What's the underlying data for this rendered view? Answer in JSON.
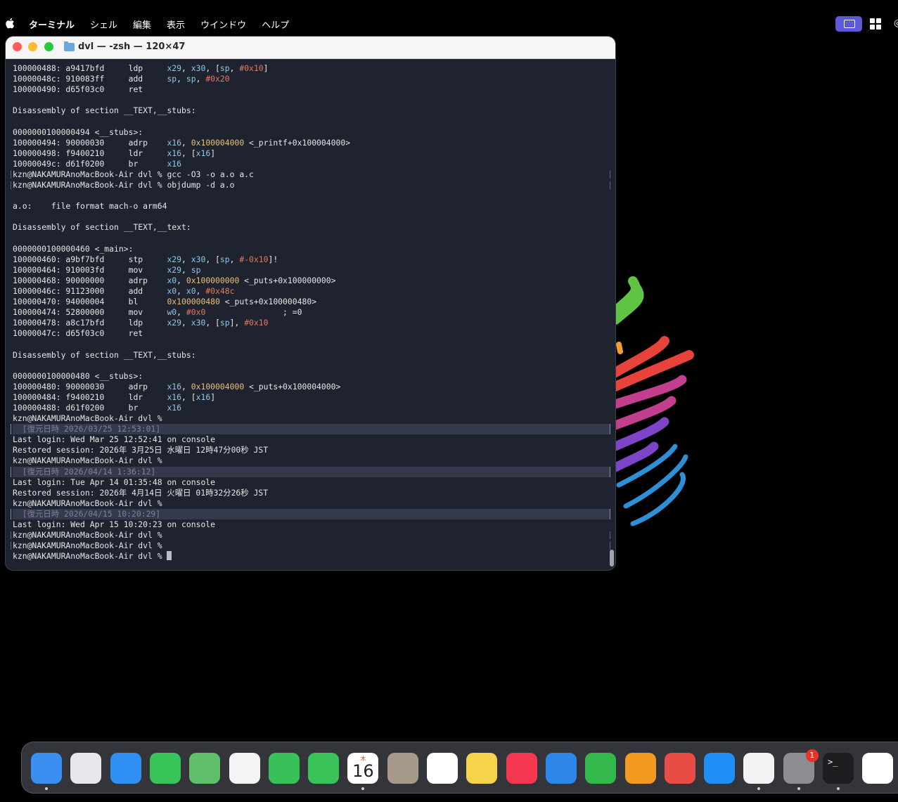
{
  "menubar": {
    "app_name": "ターミナル",
    "items": [
      "シェル",
      "編集",
      "表示",
      "ウインドウ",
      "ヘルプ"
    ]
  },
  "window": {
    "title": "dvl — -zsh — 120×47"
  },
  "terminal": {
    "lines": [
      {
        "t": "plain",
        "s": "100000488: a9417bfd     ldp     x29, x30, [sp, #0x10]"
      },
      {
        "t": "plain",
        "s": "10000048c: 910083ff     add     sp, sp, #0x20"
      },
      {
        "t": "plain",
        "s": "100000490: d65f03c0     ret"
      },
      {
        "t": "plain",
        "s": ""
      },
      {
        "t": "plain",
        "s": "Disassembly of section __TEXT,__stubs:"
      },
      {
        "t": "plain",
        "s": ""
      },
      {
        "t": "plain",
        "s": "0000000100000494 <__stubs>:"
      },
      {
        "t": "plain",
        "s": "100000494: 90000030     adrp    x16, 0x100004000 <_printf+0x100004000>"
      },
      {
        "t": "plain",
        "s": "100000498: f9400210     ldr     x16, [x16]"
      },
      {
        "t": "plain",
        "s": "10000049c: d61f0200     br      x16"
      },
      {
        "t": "prompt",
        "s": "kzn@NAKAMURAnoMacBook-Air dvl % gcc -O3 -o a.o a.c"
      },
      {
        "t": "prompt",
        "s": "kzn@NAKAMURAnoMacBook-Air dvl % objdump -d a.o"
      },
      {
        "t": "plain",
        "s": ""
      },
      {
        "t": "plain",
        "s": "a.o:    file format mach-o arm64"
      },
      {
        "t": "plain",
        "s": ""
      },
      {
        "t": "plain",
        "s": "Disassembly of section __TEXT,__text:"
      },
      {
        "t": "plain",
        "s": ""
      },
      {
        "t": "plain",
        "s": "0000000100000460 <_main>:"
      },
      {
        "t": "plain",
        "s": "100000460: a9bf7bfd     stp     x29, x30, [sp, #-0x10]!"
      },
      {
        "t": "plain",
        "s": "100000464: 910003fd     mov     x29, sp"
      },
      {
        "t": "plain",
        "s": "100000468: 90000000     adrp    x0, 0x100000000 <_puts+0x100000000>"
      },
      {
        "t": "plain",
        "s": "10000046c: 91123000     add     x0, x0, #0x48c"
      },
      {
        "t": "plain",
        "s": "100000470: 94000004     bl      0x100000480 <_puts+0x100000480>"
      },
      {
        "t": "plain",
        "s": "100000474: 52800000     mov     w0, #0x0                ; =0"
      },
      {
        "t": "plain",
        "s": "100000478: a8c17bfd     ldp     x29, x30, [sp], #0x10"
      },
      {
        "t": "plain",
        "s": "10000047c: d65f03c0     ret"
      },
      {
        "t": "plain",
        "s": ""
      },
      {
        "t": "plain",
        "s": "Disassembly of section __TEXT,__stubs:"
      },
      {
        "t": "plain",
        "s": ""
      },
      {
        "t": "plain",
        "s": "0000000100000480 <__stubs>:"
      },
      {
        "t": "plain",
        "s": "100000480: 90000030     adrp    x16, 0x100004000 <_puts+0x100004000>"
      },
      {
        "t": "plain",
        "s": "100000484: f9400210     ldr     x16, [x16]"
      },
      {
        "t": "plain",
        "s": "100000488: d61f0200     br      x16"
      },
      {
        "t": "plain",
        "s": "kzn@NAKAMURAnoMacBook-Air dvl %"
      },
      {
        "t": "mark",
        "s": "  [復元日時 2026/03/25 12:53:01]"
      },
      {
        "t": "plain",
        "s": "Last login: Wed Mar 25 12:52:41 on console"
      },
      {
        "t": "plain",
        "s": "Restored session: 2026年 3月25日 水曜日 12時47分00秒 JST"
      },
      {
        "t": "plain",
        "s": "kzn@NAKAMURAnoMacBook-Air dvl %"
      },
      {
        "t": "mark",
        "s": "  [復元日時 2026/04/14 1:36:12]"
      },
      {
        "t": "plain",
        "s": "Last login: Tue Apr 14 01:35:48 on console"
      },
      {
        "t": "plain",
        "s": "Restored session: 2026年 4月14日 火曜日 01時32分26秒 JST"
      },
      {
        "t": "plain",
        "s": "kzn@NAKAMURAnoMacBook-Air dvl %"
      },
      {
        "t": "mark",
        "s": "  [復元日時 2026/04/15 10:20:29]"
      },
      {
        "t": "plain",
        "s": "Last login: Wed Apr 15 10:20:23 on console"
      },
      {
        "t": "prompt",
        "s": "kzn@NAKAMURAnoMacBook-Air dvl %"
      },
      {
        "t": "prompt",
        "s": "kzn@NAKAMURAnoMacBook-Air dvl %"
      },
      {
        "t": "cursor",
        "s": "kzn@NAKAMURAnoMacBook-Air dvl % "
      }
    ]
  },
  "dock": {
    "items": [
      {
        "name": "finder-icon",
        "color": "#3b8ff0",
        "running": true
      },
      {
        "name": "launchpad-icon",
        "color": "#e8e8ec",
        "running": false
      },
      {
        "name": "safari-icon",
        "color": "#2f8ff2",
        "running": false
      },
      {
        "name": "messages-icon",
        "color": "#39c45a",
        "running": false
      },
      {
        "name": "maps-icon",
        "color": "#5fbf6a",
        "running": false
      },
      {
        "name": "photos-icon",
        "color": "#f4f4f4",
        "running": false
      },
      {
        "name": "facetime-icon",
        "color": "#37c158",
        "running": false
      },
      {
        "name": "phone-icon",
        "color": "#38c257",
        "running": false
      },
      {
        "name": "calendar-icon",
        "color": "#ffffff",
        "running": true
      },
      {
        "name": "contacts-icon",
        "color": "#a6998a",
        "running": false
      },
      {
        "name": "reminders-icon",
        "color": "#ffffff",
        "running": false
      },
      {
        "name": "notes-icon",
        "color": "#f5d34a",
        "running": false
      },
      {
        "name": "music-icon",
        "color": "#f5384f",
        "running": false
      },
      {
        "name": "keynote-icon",
        "color": "#2c87e8",
        "running": false
      },
      {
        "name": "numbers-icon",
        "color": "#33b84c",
        "running": false
      },
      {
        "name": "pages-icon",
        "color": "#f39a23",
        "running": false
      },
      {
        "name": "rocket-icon",
        "color": "#e94b45",
        "running": false
      },
      {
        "name": "app-store-icon",
        "color": "#1f8ef5",
        "running": false
      },
      {
        "name": "chrome-icon",
        "color": "#f3f3f3",
        "running": true
      },
      {
        "name": "system-settings-icon",
        "color": "#8b8d93",
        "running": true
      },
      {
        "name": "terminal-icon",
        "color": "#1d1d1f",
        "running": true
      },
      {
        "name": "windows-app-icon",
        "color": "#ffffff",
        "running": false
      }
    ],
    "calendar_month": "木",
    "calendar_day": "16",
    "settings_badge": "1",
    "terminal_glyph": ">_"
  }
}
